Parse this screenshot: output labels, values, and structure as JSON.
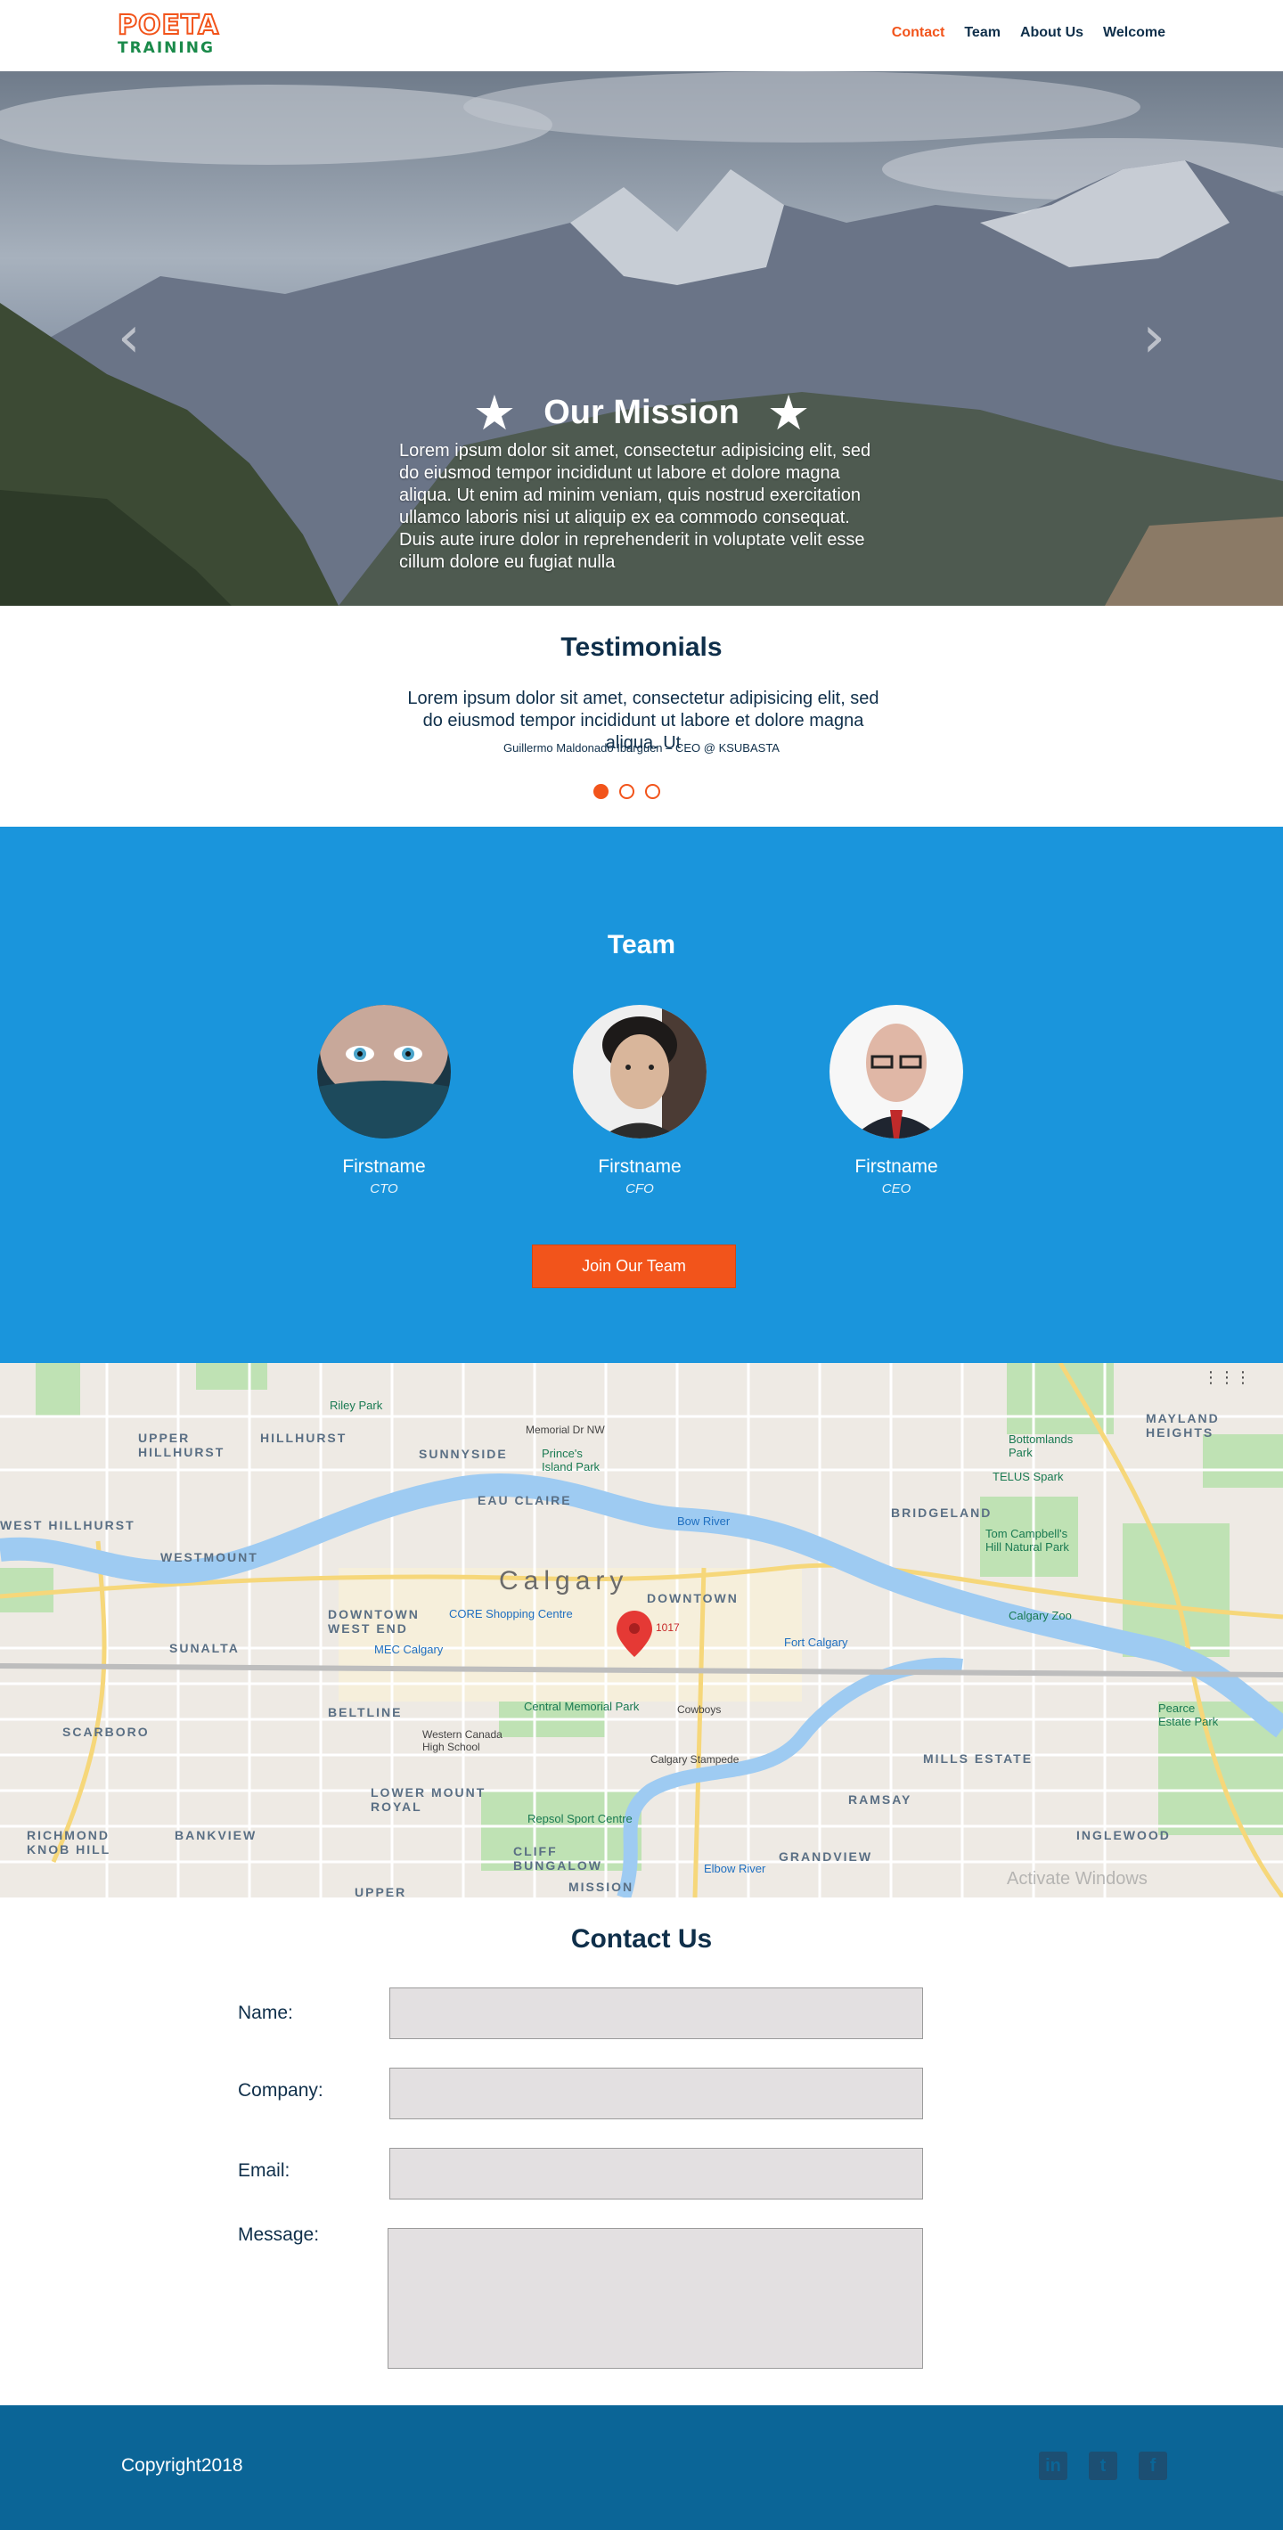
{
  "header": {
    "logo_top": "POETA",
    "logo_bottom": "TRAINING",
    "nav": [
      "Contact",
      "Team",
      "About Us",
      "Welcome"
    ],
    "active_nav": "Contact"
  },
  "hero": {
    "title": "Our Mission",
    "text": "Lorem ipsum dolor sit amet, consectetur adipisicing elit, sed do eiusmod tempor incididunt ut labore et dolore magna aliqua. Ut enim ad minim veniam, quis nostrud exercitation ullamco laboris nisi ut aliquip ex ea commodo consequat. Duis aute irure dolor in reprehenderit in voluptate velit esse cillum dolore eu fugiat nulla",
    "prev_glyph": "‹",
    "next_glyph": "›",
    "star_glyph": "★"
  },
  "testimonials": {
    "title": "Testimonials",
    "quote": "Lorem ipsum dolor sit amet, consectetur adipisicing elit, sed do eiusmod tempor incididunt ut labore et dolore magna aliqua. Ut",
    "author": "Guillermo Maldonado Ibarguen – CEO @ KSUBASTA",
    "slide_count": 3,
    "active_slide": 1
  },
  "team": {
    "title": "Team",
    "members": [
      {
        "name": "Firstname",
        "role": "CTO"
      },
      {
        "name": "Firstname",
        "role": "CFO"
      },
      {
        "name": "Firstname",
        "role": "CEO"
      }
    ],
    "join_label": "Join Our Team"
  },
  "map": {
    "city": "Calgary",
    "labels": {
      "riley_park": "Riley Park",
      "upper_hillhurst": "UPPER HILLHURST",
      "hillhurst": "HILLHURST",
      "sunnyside": "SUNNYSIDE",
      "princes_island": "Prince's Island Park",
      "eau_claire": "EAU CLAIRE",
      "west_hillhurst": "WEST HILLHURST",
      "westmount": "WESTMOUNT",
      "downtown_west_end": "DOWNTOWN WEST END",
      "downtown": "DOWNTOWN",
      "sunalta": "SUNALTA",
      "beltline": "BELTLINE",
      "scarboro": "SCARBORO",
      "lower_mount_royal": "LOWER MOUNT ROYAL",
      "bankview": "BANKVIEW",
      "richmond_knob_hill": "RICHMOND KNOB HILL",
      "cliff_bungalow": "CLIFF BUNGALOW",
      "mission": "MISSION",
      "upper": "UPPER",
      "bridgeland": "BRIDGELAND",
      "mayland_heights": "MAYLAND HEIGHTS",
      "bottomlands": "Bottomlands Park",
      "telus_spark": "TELUS Spark",
      "tom_campbell": "Tom Campbell's Hill Natural Park",
      "fort_calgary": "Fort Calgary",
      "calgary_zoo": "Calgary Zoo",
      "pearce_estate": "Pearce Estate Park",
      "mills_estate": "MILLS ESTATE",
      "ramsay": "RAMSAY",
      "inglewood": "INGLEWOOD",
      "grandview": "GRANDVIEW",
      "core_centre": "CORE Shopping Centre",
      "mec": "MEC Calgary",
      "central_memorial": "Central Memorial Park",
      "cowboys": "Cowboys",
      "western_canada": "Western Canada High School",
      "calgary_stampede": "Calgary Stampede",
      "repsol": "Repsol Sport Centre",
      "bow_river": "Bow River",
      "elbow_river": "Elbow River",
      "memorial_dr": "Memorial Dr NW",
      "pin_number": "1017",
      "watermark": "Activate Windows"
    },
    "grid_glyph": "⋮⋮⋮"
  },
  "contact": {
    "title": "Contact Us",
    "fields": [
      {
        "label": "Name:",
        "value": ""
      },
      {
        "label": "Company:",
        "value": ""
      },
      {
        "label": "Email:",
        "value": ""
      },
      {
        "label": "Message:",
        "value": ""
      }
    ]
  },
  "footer": {
    "copyright": "Copyright2018",
    "socials": [
      {
        "icon": "linkedin-icon",
        "glyph": "in"
      },
      {
        "icon": "twitter-icon",
        "glyph": "t"
      },
      {
        "icon": "facebook-icon",
        "glyph": "f"
      }
    ]
  },
  "colors": {
    "accent": "#f2541b",
    "navy": "#0f2f4a",
    "team_bg": "#1a95dc",
    "footer_bg": "#0b6597",
    "input_bg": "#e3e0e1"
  }
}
